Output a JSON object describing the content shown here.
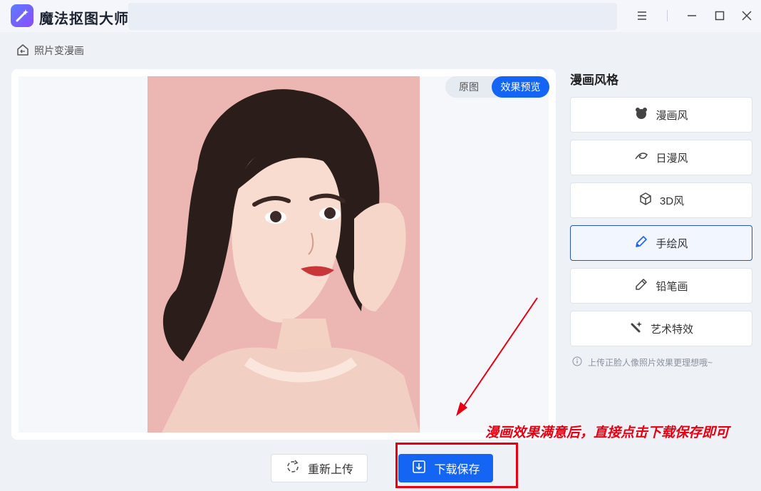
{
  "app": {
    "title": "魔法抠图大师"
  },
  "window_controls": [
    "menu-icon",
    "minimize-icon",
    "maximize-icon",
    "close-icon"
  ],
  "breadcrumb": {
    "label": "照片变漫画"
  },
  "preview": {
    "toggle": {
      "original_label": "原图",
      "effect_label": "效果预览",
      "selected": "效果预览"
    }
  },
  "sidebar": {
    "title": "漫画风格",
    "styles": [
      {
        "label": "漫画风",
        "icon": "bear-icon",
        "active": false
      },
      {
        "label": "日漫风",
        "icon": "swirl-icon",
        "active": false
      },
      {
        "label": "3D风",
        "icon": "cube-icon",
        "active": false
      },
      {
        "label": "手绘风",
        "icon": "brush-icon",
        "active": true
      },
      {
        "label": "铅笔画",
        "icon": "pencil-icon",
        "active": false
      },
      {
        "label": "艺术特效",
        "icon": "magic-wand-icon",
        "active": false
      }
    ],
    "tip": "上传正脸人像照片效果更理想哦~"
  },
  "actions": {
    "reupload_label": "重新上传",
    "download_label": "下载保存"
  },
  "annotation": {
    "text": "漫画效果满意后，直接点击下载保存即可"
  },
  "colors": {
    "accent": "#1565f5",
    "annotation_red": "#e60012",
    "photo_background": "#ecb7b2"
  }
}
